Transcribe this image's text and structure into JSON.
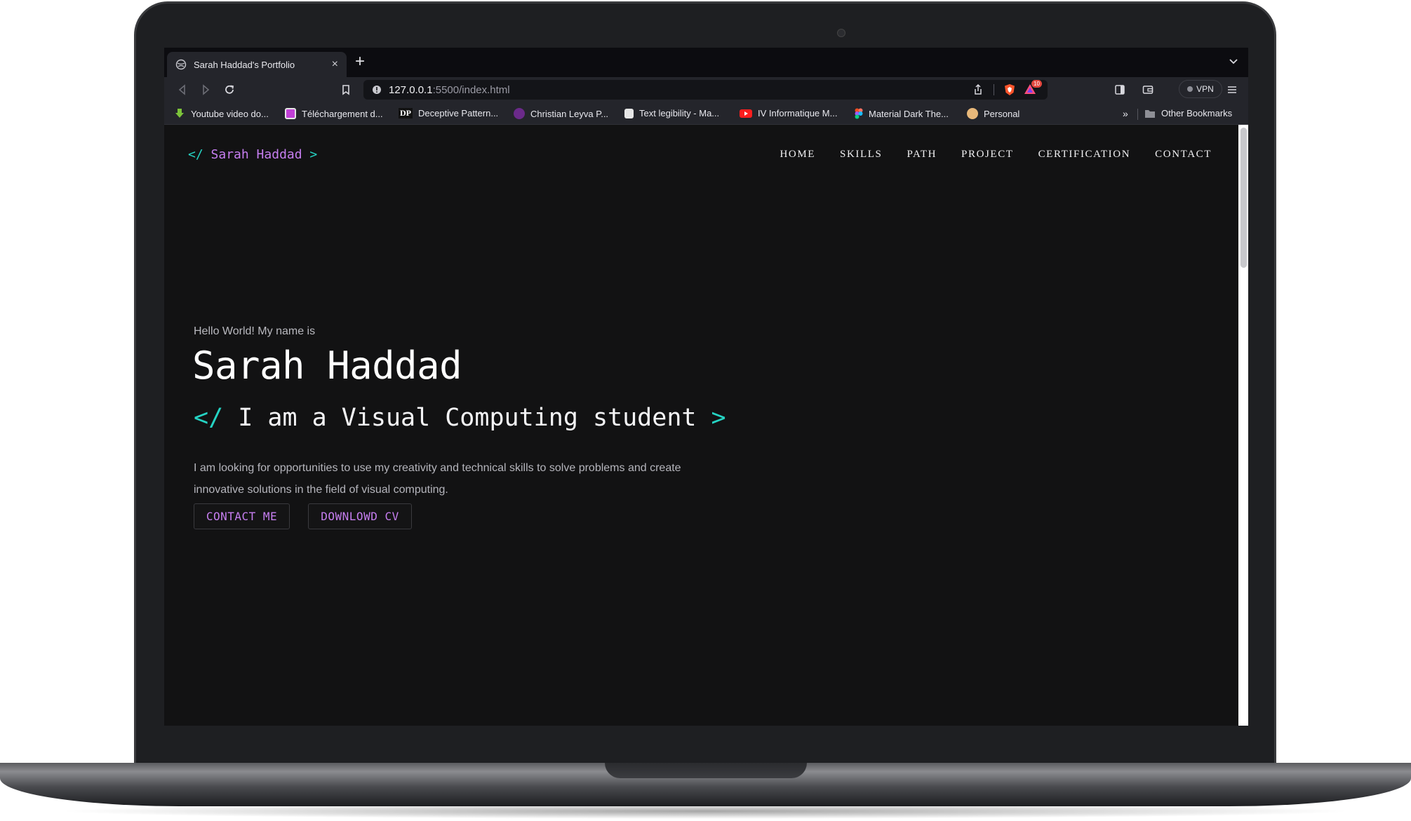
{
  "browser": {
    "tab_title": "Sarah Haddad's Portfolio",
    "tab_close": "×",
    "new_tab": "+",
    "url_host": "127.0.0.1",
    "url_path": ":5500/index.html",
    "vpn_label": "VPN",
    "shield_badge": "10",
    "bookmarks_overflow": "»",
    "bookmarks": [
      {
        "label": "Youtube video do...",
        "icon": "green-download-icon",
        "color": "#7cc33a"
      },
      {
        "label": "Téléchargement d...",
        "icon": "purple-square-icon",
        "color": "#c03fd6"
      },
      {
        "label": "Deceptive Pattern...",
        "icon": "dp-logo-icon",
        "color": "#f1f1f1"
      },
      {
        "label": "Christian Leyva P...",
        "icon": "purple-circle-icon",
        "color": "#6b2a8a"
      },
      {
        "label": "Text legibility - Ma...",
        "icon": "white-square-icon",
        "color": "#e6e6e6"
      },
      {
        "label": "IV Informatique M...",
        "icon": "youtube-icon",
        "color": "#ff1e1e"
      },
      {
        "label": "Material Dark The...",
        "icon": "figma-icon",
        "color": "#f24e1e"
      },
      {
        "label": "Personal",
        "icon": "avatar-icon",
        "color": "#e8b87a"
      }
    ],
    "other_bookmarks": "Other Bookmarks"
  },
  "site": {
    "logo_open": "</",
    "logo_name": "Sarah Haddad",
    "logo_close": ">",
    "nav": [
      "HOME",
      "SKILLS",
      "PATH",
      "PROJECT",
      "CERTIFICATION",
      "CONTACT"
    ]
  },
  "hero": {
    "greeting": "Hello World! My name is",
    "name": "Sarah Haddad",
    "role_open": "</",
    "role_text": "I am a Visual Computing student",
    "role_close": ">",
    "description": "I am looking for opportunities to use my creativity and technical skills to solve problems and create innovative solutions in the field of visual computing.",
    "btn_contact": "CONTACT ME",
    "btn_cv": "DOWNLOWD CV"
  },
  "colors": {
    "accent_purple": "#c67ef0",
    "accent_teal": "#25d3c3",
    "page_bg": "#121213"
  }
}
